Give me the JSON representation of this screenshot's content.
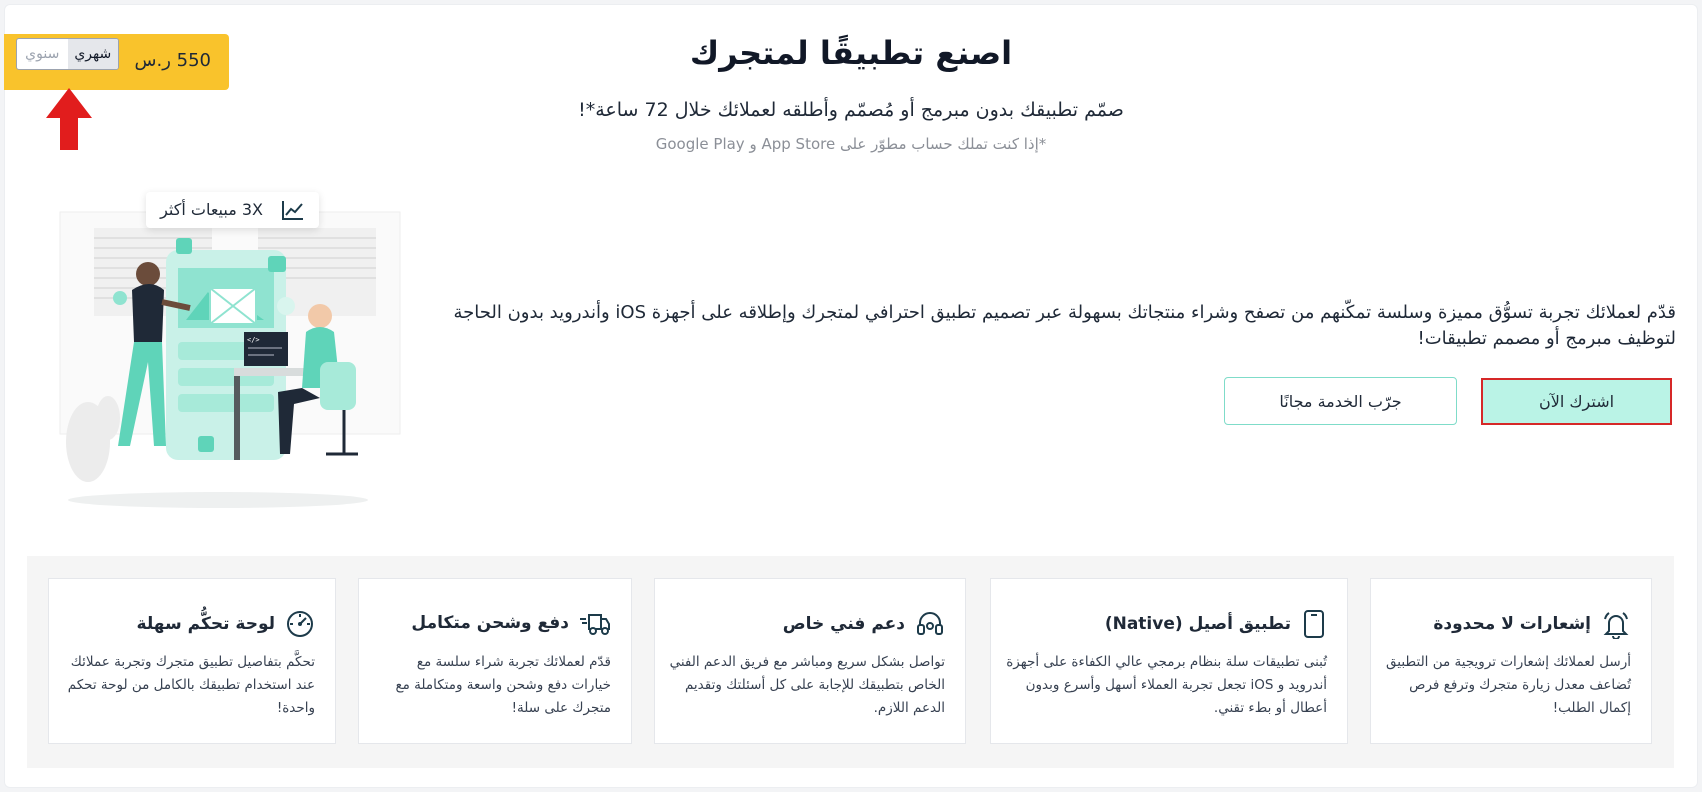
{
  "pricing": {
    "price": "550 ر.س",
    "toggle_monthly": "شهري",
    "toggle_yearly": "سنوي"
  },
  "hero": {
    "title": "اصنع تطبيقًا لمتجرك",
    "subtitle": "صمّم تطبيقك بدون مبرمج أو مُصمّم وأطلقه لعملائك خلال 72 ساعة*!",
    "note": "*إذا كنت تملك حساب مطوّر على App Store و Google Play",
    "description": "قدّم لعملائك تجربة تسوُّق مميزة وسلسة تمكّنهم من تصفح وشراء منتجاتك بسهولة عبر تصميم تطبيق احترافي لمتجرك وإطلاقه على أجهزة iOS وأندرويد بدون الحاجة لتوظيف مبرمج أو مصمم تطبيقات!",
    "subscribe_label": "اشترك الآن",
    "try_label": "جرّب الخدمة مجانًا"
  },
  "illustration": {
    "badge_text": "3X مبيعات أكثر",
    "badge_icon": "trend-chart-icon",
    "code_tag": "</>"
  },
  "features": [
    {
      "icon": "bell-icon",
      "title": "إشعارات لا محدودة",
      "body": "أرسل لعملائك إشعارات ترويجية من التطبيق تُضاعف معدل زيارة متجرك وترفع فرص إكمال الطلب!"
    },
    {
      "icon": "phone-icon",
      "title": "تطبيق أصيل (Native)",
      "body": "تُبنى تطبيقات سلة بنظام برمجي عالي الكفاءة على أجهزة أندرويد و iOS تجعل تجربة العملاء أسهل وأسرع وبدون أعطال أو بطء تقني."
    },
    {
      "icon": "headset-icon",
      "title": "دعم فني خاص",
      "body": "تواصل بشكل سريع ومباشر مع فريق الدعم الفني الخاص بتطبيقك للإجابة على كل أسئلتك وتقديم الدعم اللازم."
    },
    {
      "icon": "delivery-truck-icon",
      "title": "دفع وشحن متكامل",
      "body": "قدّم لعملائك تجربة شراء سلسة مع خيارات دفع وشحن واسعة ومتكاملة مع متجرك على سلة!"
    },
    {
      "icon": "speedometer-icon",
      "title": "لوحة تحكُّم سهلة",
      "body": "تحكَّم بتفاصيل تطبيق متجرك وتجربة عملائك عند استخدام تطبيقك بالكامل من لوحة تحكم واحدة!"
    }
  ],
  "colors": {
    "accent_yellow": "#f9c32c",
    "accent_mint": "#baf3e6",
    "highlight_red": "#d62828",
    "icon_dark": "#1d3b4a"
  }
}
